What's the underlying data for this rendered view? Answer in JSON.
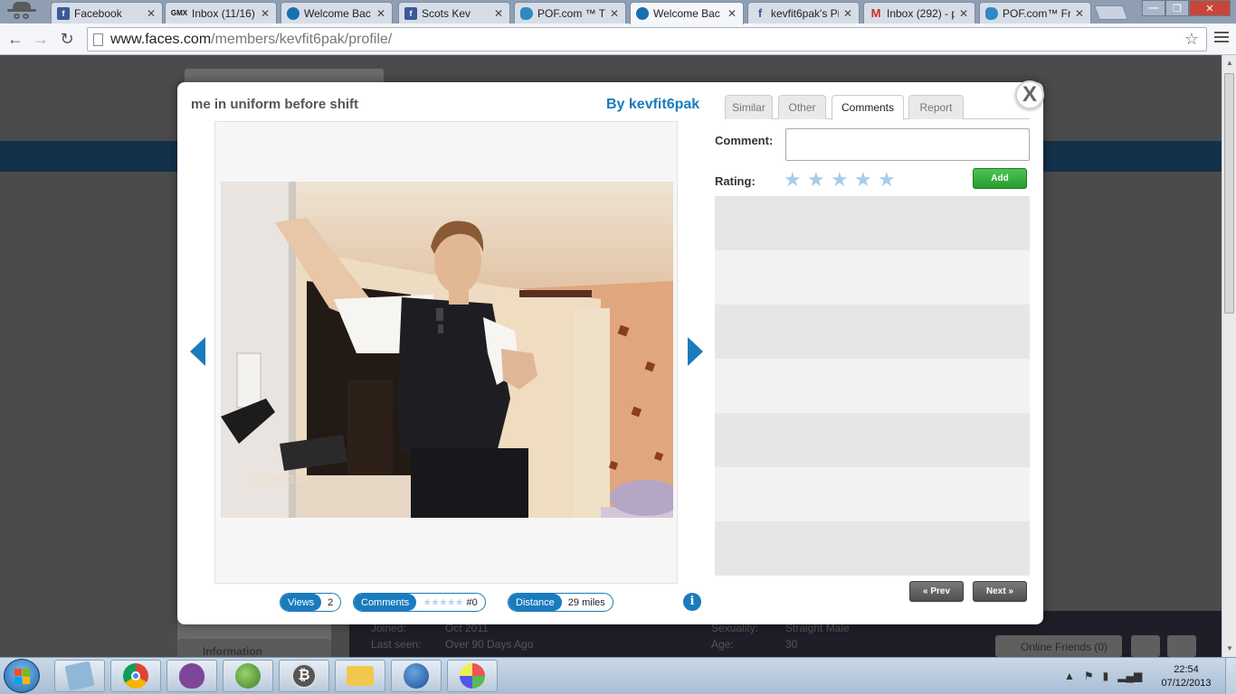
{
  "browser": {
    "tabs": [
      {
        "label": "Facebook",
        "icon": "facebook-icon"
      },
      {
        "label": "Inbox (11/16)",
        "icon": "gmx-icon"
      },
      {
        "label": "Welcome Bac",
        "icon": "faces-icon"
      },
      {
        "label": "Scots Kev",
        "icon": "facebook-icon"
      },
      {
        "label": "POF.com ™ Th",
        "icon": "pof-icon"
      },
      {
        "label": "Welcome Bac",
        "icon": "faces-icon"
      },
      {
        "label": "kevfit6pak's Pi",
        "icon": "facebook-f-icon"
      },
      {
        "label": "Inbox (292) - p",
        "icon": "gmail-icon"
      },
      {
        "label": "POF.com™ Fr",
        "icon": "pof-icon"
      }
    ],
    "active_tab_index": 5,
    "url_host": "www.faces.com",
    "url_path": "/members/kevfit6pak/profile/"
  },
  "background_page": {
    "profile_rows": [
      {
        "label": "Joined:",
        "value": "Oct 2011"
      },
      {
        "label": "Last seen:",
        "value": "Over 90 Days Ago"
      },
      {
        "label": "Sexuality:",
        "value": "Straight Male"
      },
      {
        "label": "Age:",
        "value": "30"
      }
    ],
    "info_tab": "Information",
    "online_friends": "Online Friends (0)"
  },
  "photo_modal": {
    "title": "me in uniform before shift",
    "owner": "By kevfit6pak",
    "photo_date_stamp": "01/15/2010",
    "tabs": [
      "Similar",
      "Other",
      "Comments",
      "Report"
    ],
    "active_tab": "Comments",
    "comment_label": "Comment:",
    "comment_value": "",
    "rating_label": "Rating:",
    "rating_stars": 5,
    "rating_value": 0,
    "add_button": "Add",
    "prev_button": "« Prev",
    "next_button": "Next »",
    "close_glyph": "X",
    "stats": {
      "views_label": "Views",
      "views_value": "2",
      "comments_label": "Comments",
      "comments_value": "#0",
      "distance_label": "Distance",
      "distance_value": "29 miles"
    }
  },
  "taskbar": {
    "apps": [
      "notepad-icon",
      "chrome-icon",
      "tor-onion-icon",
      "globe-icon",
      "bitcoin-icon",
      "folder-icon",
      "thunderbird-icon",
      "paint-icon"
    ],
    "time": "22:54",
    "date": "07/12/2013"
  },
  "colors": {
    "accent_blue": "#1a7bbd",
    "add_green": "#2fae36",
    "overlay": "#4b4b4b"
  }
}
